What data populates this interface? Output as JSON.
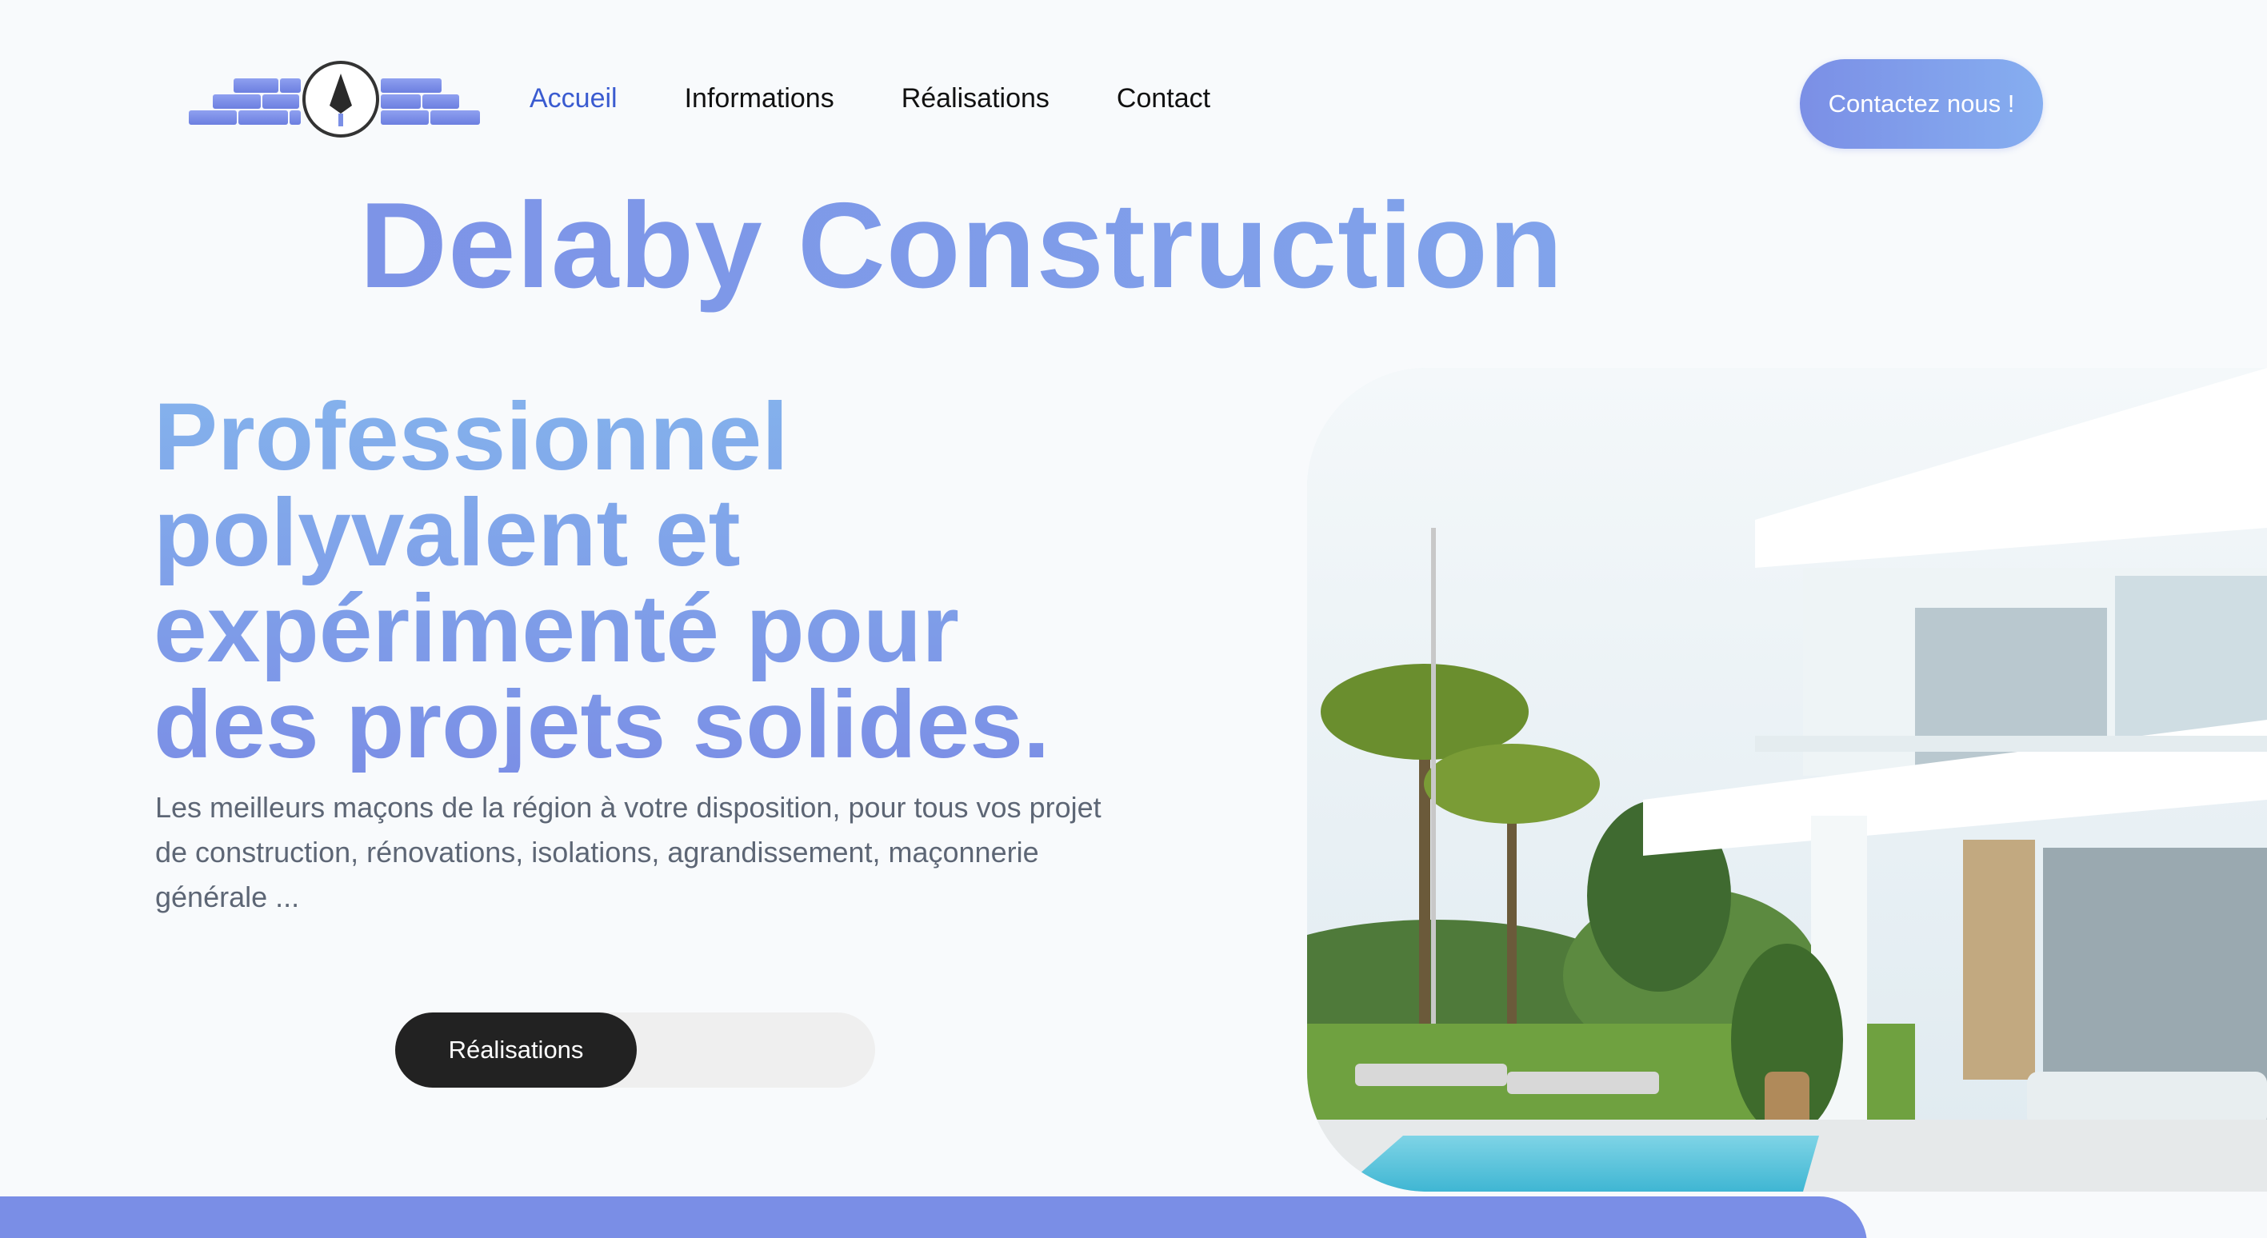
{
  "nav": {
    "logo_icon": "trowel-brick-logo",
    "items": [
      {
        "label": "Accueil",
        "active": true
      },
      {
        "label": "Informations",
        "active": false
      },
      {
        "label": "Réalisations",
        "active": false
      },
      {
        "label": "Contact",
        "active": false
      }
    ],
    "cta_label": "Contactez nous !"
  },
  "brand": {
    "title": "Delaby Construction"
  },
  "hero": {
    "heading_lines": [
      "Professionnel",
      "polyvalent et",
      "expérimenté pour",
      "des projets solides."
    ],
    "description": "Les meilleurs maçons de la région à votre disposition, pour tous vos projet de construction, rénovations, isolations, agrandissement, maçonnerie générale ...",
    "toggle_label": "Réalisations",
    "image_subject": "modern-white-villa-with-pool-photo"
  },
  "colors": {
    "accent": "#7b8fe6",
    "accent_light": "#84b2ec",
    "active_link": "#3a5bd0",
    "dark_button": "#222222",
    "background": "#f8fafc"
  }
}
